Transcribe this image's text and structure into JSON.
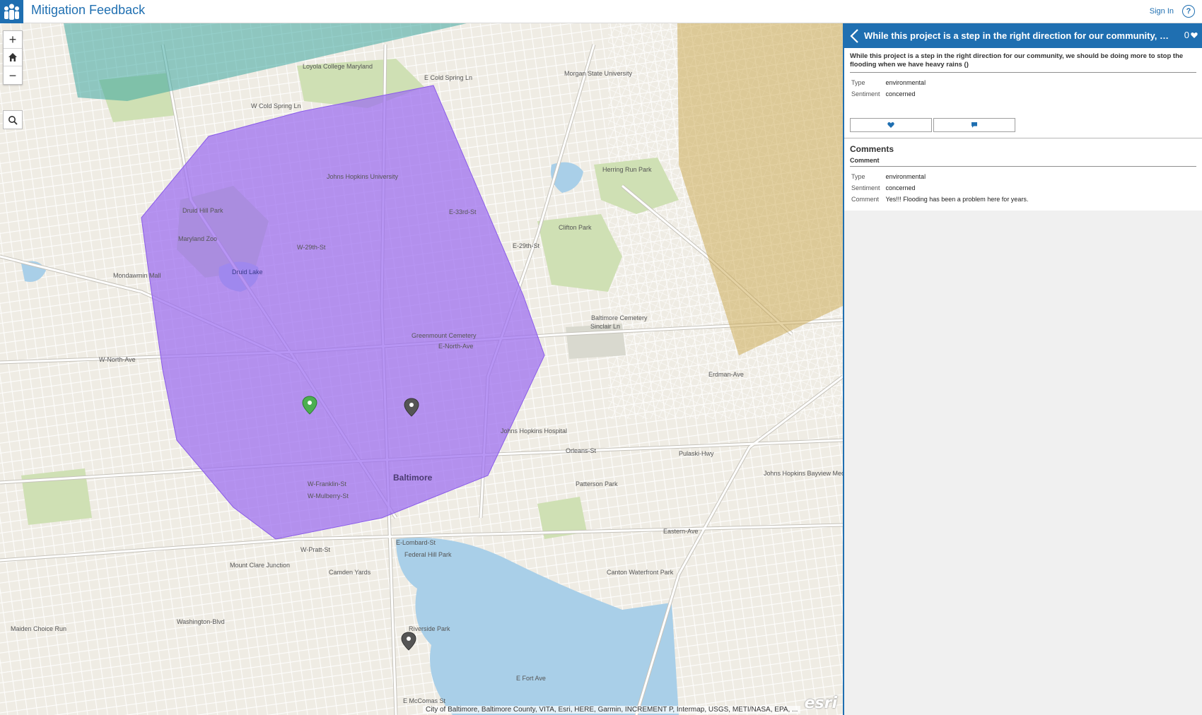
{
  "header": {
    "title": "Mitigation Feedback",
    "sign_in_label": "Sign In",
    "help_label": "?"
  },
  "map": {
    "zoom_in_label": "+",
    "zoom_out_label": "−",
    "attribution": "City of Baltimore, Baltimore County, VITA, Esri, HERE, Garmin, INCREMENT P, Intermap, USGS, METI/NASA, EPA, ...",
    "logo_text": "esri",
    "colors": {
      "purple_area": "#9b6cf0",
      "teal_area": "#3ea8a0",
      "olive_area": "#c9a64a",
      "water": "#a9cfe8",
      "park": "#cfe0b4",
      "road": "#ffffff",
      "major_road": "#c8c8c8"
    },
    "labels": {
      "baltimore": "Baltimore",
      "mondawmin": "Mondawmin Mall",
      "druid_hill": "Druid Hill Park",
      "druid_lake": "Druid Lake",
      "maryland_zoo": "Maryland Zoo",
      "greenmount": "Greenmount Cemetery",
      "clifton_park": "Clifton Park",
      "herring_run": "Herring Run Park",
      "patterson": "Patterson Park",
      "canton": "Canton Waterfront Park",
      "riverside": "Riverside Park",
      "federal_hill": "Federal Hill Park",
      "johns_hopkins_university": "Johns Hopkins University",
      "loyola": "Loyola College Maryland",
      "morgan_state": "Morgan State University",
      "baltimore_cemetery": "Baltimore Cemetery",
      "jh_hospital": "Johns Hopkins Hospital",
      "jh_bayview": "Johns Hopkins Bayview Medical Center",
      "north_ave": "W-North-Ave",
      "e_north_ave": "E-North-Ave",
      "pulaski": "Pulaski-Hwy",
      "orleans": "Orleans-St",
      "eastern": "Eastern-Ave",
      "franklin": "W-Franklin-St",
      "mulberry": "W-Mulberry-St",
      "pratt": "W-Pratt-St",
      "lombard": "E-Lombard-St",
      "washington_blvd": "Washington-Blvd",
      "erdman": "Erdman-Ave",
      "e_33rd": "E-33rd-St",
      "w_29th": "W-29th-St",
      "e_29th": "E-29th-St",
      "w_cold_spring": "W Cold Spring Ln",
      "e_cold_spring": "E Cold Spring Ln",
      "sinclair": "Sinclair Ln",
      "mt_clare": "Mount Clare Junction",
      "camden": "Camden Yards",
      "md_choice": "Maiden Choice Run",
      "fort_ave": "E Fort Ave",
      "mccomas": "E McComas St"
    }
  },
  "panel": {
    "title": "While this project is a step in the right direction for our community, we ...",
    "vote_count": "0",
    "feedback_text": "While this project is a step in the right direction for our community, we should be doing more to stop the flooding when we have heavy rains ()",
    "attributes": [
      {
        "key": "Type",
        "value": "environmental"
      },
      {
        "key": "Sentiment",
        "value": "concerned"
      }
    ],
    "comments_title": "Comments",
    "comment_heading": "Comment",
    "comment_attributes": [
      {
        "key": "Type",
        "value": "environmental"
      },
      {
        "key": "Sentiment",
        "value": "concerned"
      },
      {
        "key": "Comment",
        "value": "Yes!!! Flooding has been a problem here for years."
      }
    ]
  }
}
